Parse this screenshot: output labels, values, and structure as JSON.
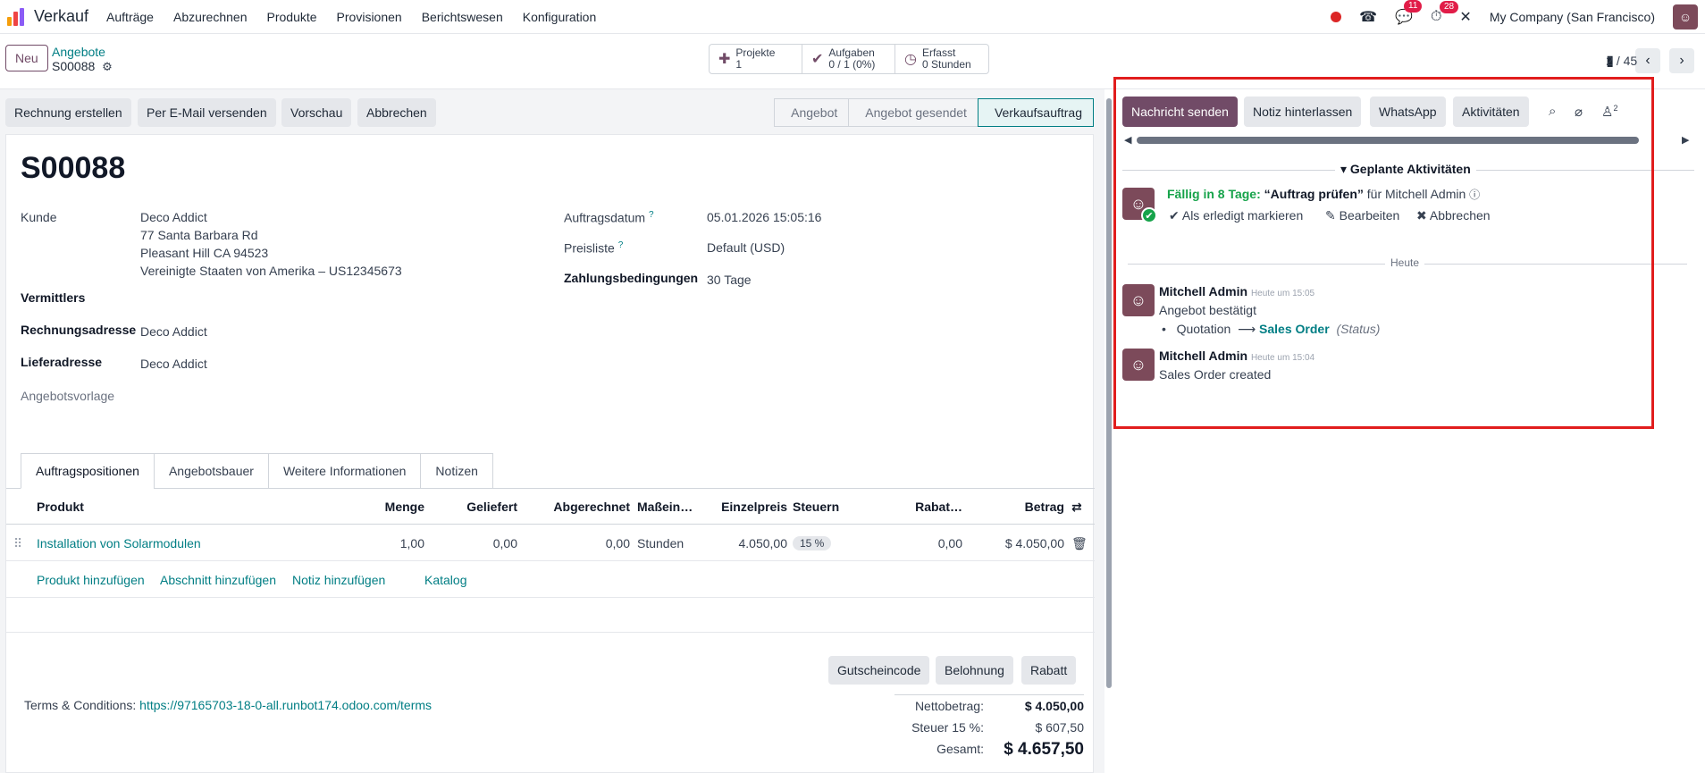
{
  "nav": {
    "app_name": "Verkauf",
    "menu": [
      "Aufträge",
      "Abzurechnen",
      "Produkte",
      "Provisionen",
      "Berichtswesen",
      "Konfiguration"
    ],
    "messages_badge": "11",
    "activities_badge": "28",
    "company": "My Company (San Francisco)"
  },
  "control": {
    "new_button": "Neu",
    "breadcrumb_parent": "Angebote",
    "breadcrumb_current": "S00088",
    "smart_buttons": [
      {
        "label": "Projekte",
        "value": "1"
      },
      {
        "label": "Aufgaben",
        "value": "0 / 1 (0%)"
      },
      {
        "label": "Erfasst",
        "value": "0 Stunden"
      }
    ],
    "pager": "2 / 45"
  },
  "actions": {
    "invoice": "Rechnung erstellen",
    "email": "Per E-Mail versenden",
    "preview": "Vorschau",
    "cancel": "Abbrechen"
  },
  "stages": [
    "Angebot",
    "Angebot gesendet",
    "Verkaufsauftrag"
  ],
  "order": {
    "name": "S00088",
    "customer_label": "Kunde",
    "customer_name": "Deco Addict",
    "address_1": "77 Santa Barbara Rd",
    "address_2": "Pleasant Hill CA 94523",
    "address_3": "Vereinigte Staaten von Amerika – US12345673",
    "intermediary_label": "Vermittlers",
    "invoice_addr_label": "Rechnungsadresse",
    "invoice_addr": "Deco Addict",
    "delivery_addr_label": "Lieferadresse",
    "delivery_addr": "Deco Addict",
    "template_label": "Angebotsvorlage",
    "order_date_label": "Auftragsdatum",
    "order_date": "05.01.2026 15:05:16",
    "pricelist_label": "Preisliste",
    "pricelist": "Default (USD)",
    "payment_terms_label": "Zahlungsbedingungen",
    "payment_terms": "30 Tage",
    "help_mark": "?"
  },
  "tabs": [
    "Auftragspositionen",
    "Angebotsbauer",
    "Weitere Informationen",
    "Notizen"
  ],
  "lines": {
    "headers": {
      "product": "Produkt",
      "qty": "Menge",
      "delivered": "Geliefert",
      "invoiced": "Abgerechnet",
      "uom": "Maßein…",
      "price": "Einzelpreis",
      "taxes": "Steuern",
      "discount": "Rabat…",
      "amount": "Betrag"
    },
    "rows": [
      {
        "product": "Installation von Solarmodulen",
        "qty": "1,00",
        "delivered": "0,00",
        "invoiced": "0,00",
        "uom": "Stunden",
        "price": "4.050,00",
        "taxes": "15 %",
        "discount": "0,00",
        "amount": "$ 4.050,00"
      }
    ],
    "add_product": "Produkt hinzufügen",
    "add_section": "Abschnitt hinzufügen",
    "add_note": "Notiz hinzufügen",
    "catalog": "Katalog"
  },
  "bottom_buttons": {
    "coupon": "Gutscheincode",
    "reward": "Belohnung",
    "discount": "Rabatt"
  },
  "terms": {
    "label": "Terms & Conditions:",
    "url": "https://97165703-18-0-all.runbot174.odoo.com/terms"
  },
  "totals": {
    "net_label": "Nettobetrag:",
    "net": "$ 4.050,00",
    "tax_label": "Steuer 15 %:",
    "tax": "$ 607,50",
    "total_label": "Gesamt:",
    "total": "$ 4.657,50"
  },
  "chatter": {
    "send_message": "Nachricht senden",
    "log_note": "Notiz hinterlassen",
    "whatsapp": "WhatsApp",
    "activities": "Aktivitäten",
    "followers_count": "2",
    "planned_title": "Geplante Aktivitäten",
    "activity": {
      "due": "Fällig in 8 Tage:",
      "summary": "“Auftrag prüfen”",
      "assignee": "für Mitchell Admin",
      "mark_done": "Als erledigt markieren",
      "edit": "Bearbeiten",
      "cancel": "Abbrechen"
    },
    "today_label": "Heute",
    "messages": [
      {
        "author": "Mitchell Admin",
        "time": "Heute um 15:05",
        "body": "Angebot bestätigt",
        "change_from": "Quotation",
        "change_to": "Sales Order",
        "change_field": "(Status)"
      },
      {
        "author": "Mitchell Admin",
        "time": "Heute um 15:04",
        "body": "Sales Order created"
      }
    ]
  },
  "colors": {
    "brand": "#714b67",
    "link": "#017e84",
    "highlight": "#e11d1d"
  }
}
